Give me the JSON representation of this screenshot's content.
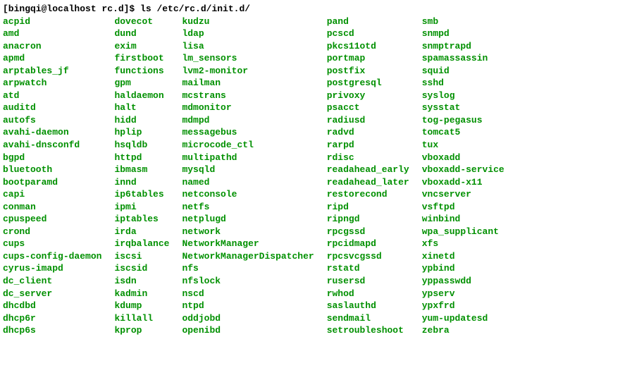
{
  "prompt": "[bingqi@localhost rc.d]$",
  "command": "ls /etc/rc.d/init.d/",
  "columns": [
    [
      "acpid",
      "amd",
      "anacron",
      "apmd",
      "arptables_jf",
      "arpwatch",
      "atd",
      "auditd",
      "autofs",
      "avahi-daemon",
      "avahi-dnsconfd",
      "bgpd",
      "bluetooth",
      "bootparamd",
      "capi",
      "conman",
      "cpuspeed",
      "crond",
      "cups",
      "cups-config-daemon",
      "cyrus-imapd",
      "dc_client",
      "dc_server",
      "dhcdbd",
      "dhcp6r",
      "dhcp6s"
    ],
    [
      "dovecot",
      "dund",
      "exim",
      "firstboot",
      "functions",
      "gpm",
      "haldaemon",
      "halt",
      "hidd",
      "hplip",
      "hsqldb",
      "httpd",
      "ibmasm",
      "innd",
      "ip6tables",
      "ipmi",
      "iptables",
      "irda",
      "irqbalance",
      "iscsi",
      "iscsid",
      "isdn",
      "kadmin",
      "kdump",
      "killall",
      "kprop"
    ],
    [
      "kudzu",
      "ldap",
      "lisa",
      "lm_sensors",
      "lvm2-monitor",
      "mailman",
      "mcstrans",
      "mdmonitor",
      "mdmpd",
      "messagebus",
      "microcode_ctl",
      "multipathd",
      "mysqld",
      "named",
      "netconsole",
      "netfs",
      "netplugd",
      "network",
      "NetworkManager",
      "NetworkManagerDispatcher",
      "nfs",
      "nfslock",
      "nscd",
      "ntpd",
      "oddjobd",
      "openibd"
    ],
    [
      "pand",
      "pcscd",
      "pkcs11otd",
      "portmap",
      "postfix",
      "postgresql",
      "privoxy",
      "psacct",
      "radiusd",
      "radvd",
      "rarpd",
      "rdisc",
      "readahead_early",
      "readahead_later",
      "restorecond",
      "ripd",
      "ripngd",
      "rpcgssd",
      "rpcidmapd",
      "rpcsvcgssd",
      "rstatd",
      "rusersd",
      "rwhod",
      "saslauthd",
      "sendmail",
      "setroubleshoot"
    ],
    [
      "smb",
      "snmpd",
      "snmptrapd",
      "spamassassin",
      "squid",
      "sshd",
      "syslog",
      "sysstat",
      "tog-pegasus",
      "tomcat5",
      "tux",
      "vboxadd",
      "vboxadd-service",
      "vboxadd-x11",
      "vncserver",
      "vsftpd",
      "winbind",
      "wpa_supplicant",
      "xfs",
      "xinetd",
      "ypbind",
      "yppasswdd",
      "ypserv",
      "ypxfrd",
      "yum-updatesd",
      "zebra"
    ]
  ]
}
